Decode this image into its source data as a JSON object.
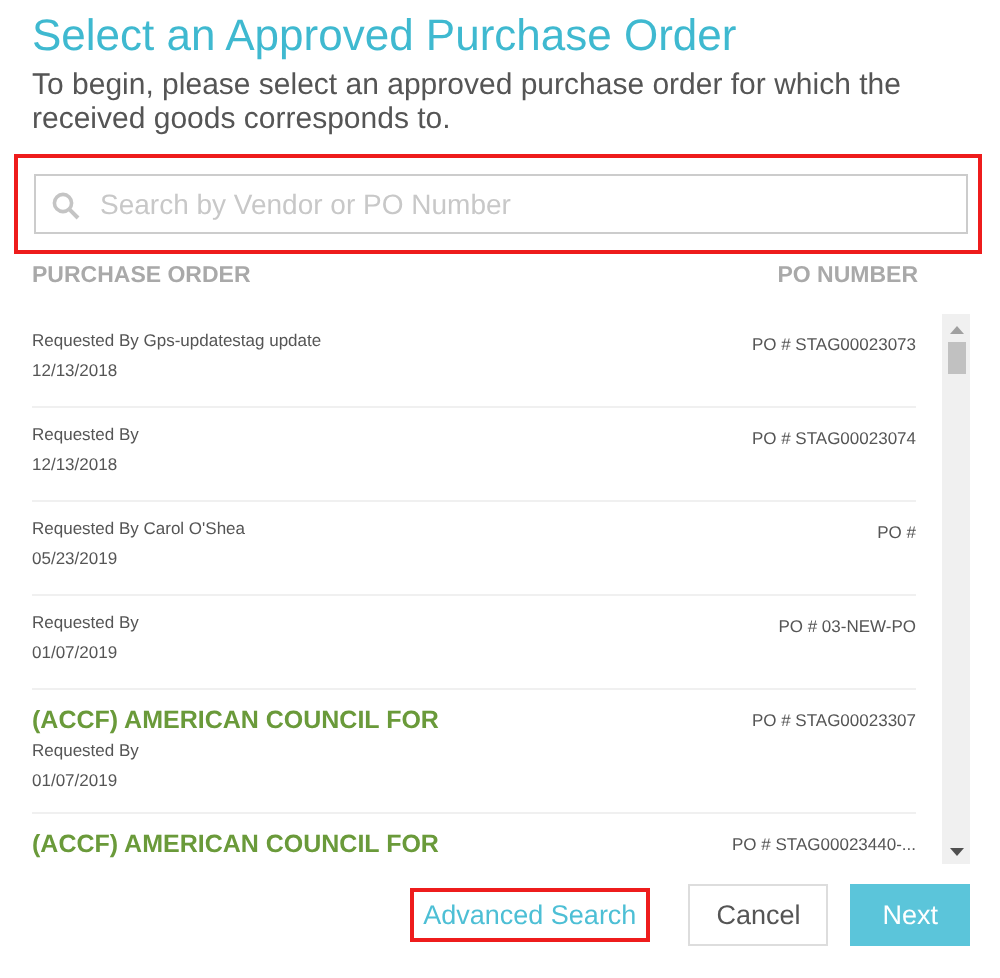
{
  "title": "Select an Approved Purchase Order",
  "subtitle": "To begin, please select an approved purchase order for which the received goods corresponds to.",
  "search": {
    "placeholder": "Search by Vendor or PO Number",
    "highlighted": true
  },
  "columns": [
    "PURCHASE ORDER",
    "PO NUMBER"
  ],
  "rows": [
    {
      "requested_by": "Requested By Gps-updatestag update",
      "date": "12/13/2018",
      "po_number": "PO # STAG00023073"
    },
    {
      "requested_by": "Requested By",
      "date": "12/13/2018",
      "po_number": "PO # STAG00023074"
    },
    {
      "requested_by": "Requested By Carol O'Shea",
      "date": "05/23/2019",
      "po_number": "PO #"
    },
    {
      "requested_by": "Requested By",
      "date": "01/07/2019",
      "po_number": "PO # 03-NEW-PO"
    },
    {
      "vendor": "(ACCF) AMERICAN COUNCIL FOR",
      "requested_by": "Requested By",
      "date": "01/07/2019",
      "po_number": "PO # STAG00023307"
    },
    {
      "vendor": "(ACCF) AMERICAN COUNCIL FOR",
      "po_number": "PO # STAG00023440-..."
    }
  ],
  "buttons": [
    {
      "kind": "link",
      "label": "Advanced Search",
      "highlighted": true
    },
    {
      "kind": "secondary",
      "label": "Cancel",
      "highlighted": false
    },
    {
      "kind": "primary",
      "label": "Next",
      "highlighted": false
    }
  ]
}
